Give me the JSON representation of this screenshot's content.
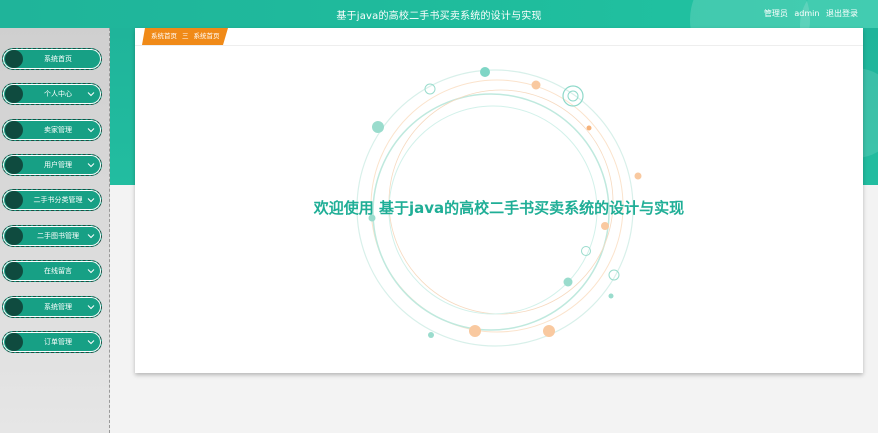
{
  "header": {
    "title": "基于java的高校二手书买卖系统的设计与实现",
    "role": "管理员",
    "username": "admin",
    "logout_label": "退出登录"
  },
  "sidebar": {
    "items": [
      {
        "label": "系统首页",
        "has_dropdown": false
      },
      {
        "label": "个人中心",
        "has_dropdown": true
      },
      {
        "label": "卖家管理",
        "has_dropdown": true
      },
      {
        "label": "用户管理",
        "has_dropdown": true
      },
      {
        "label": "二手书分类管理",
        "has_dropdown": true
      },
      {
        "label": "二手图书管理",
        "has_dropdown": true
      },
      {
        "label": "在线留言",
        "has_dropdown": true
      },
      {
        "label": "系统管理",
        "has_dropdown": true
      },
      {
        "label": "订单管理",
        "has_dropdown": true
      }
    ]
  },
  "breadcrumb": {
    "root": "系统首页",
    "separator": "三",
    "current": "系统首页"
  },
  "main": {
    "welcome_text": "欢迎使用 基于java的高校二手书买卖系统的设计与实现"
  },
  "colors": {
    "primary": "#1fb49a",
    "accent": "#f08a18",
    "sidebar_item": "#17a085",
    "welcome_text": "#1fae96"
  }
}
